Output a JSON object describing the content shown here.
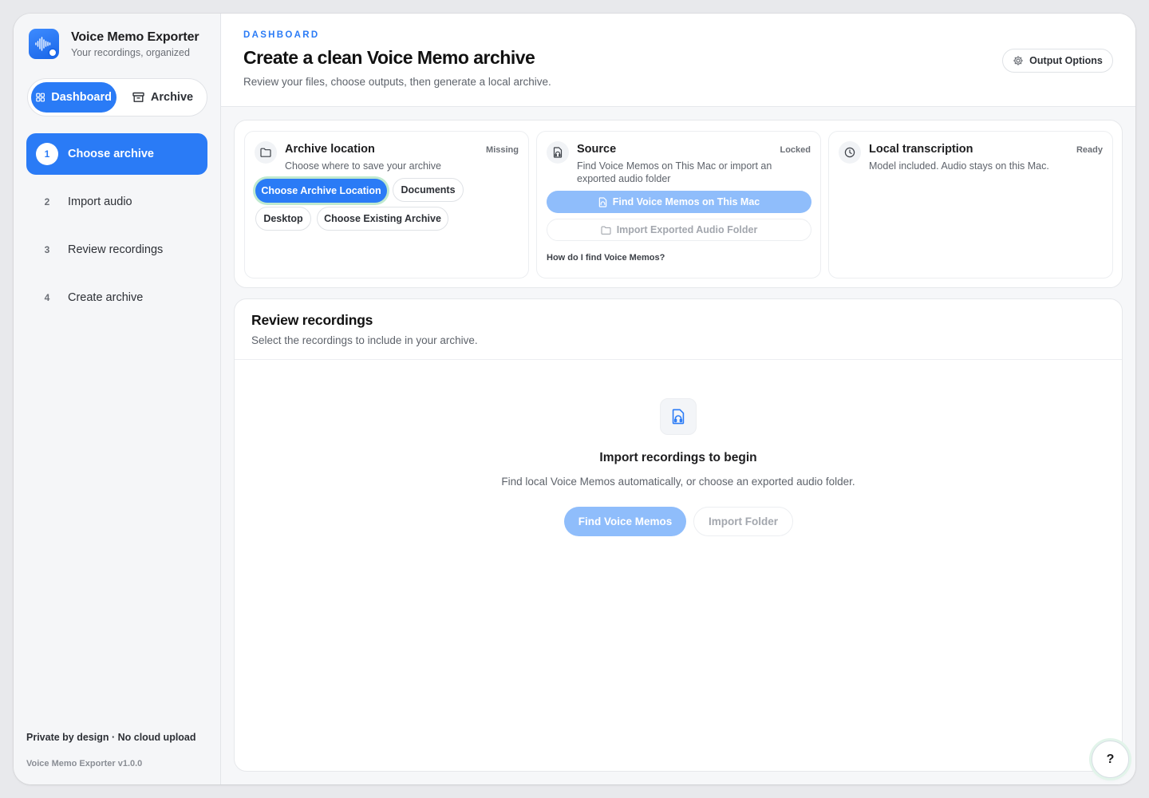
{
  "app": {
    "title": "Voice Memo Exporter",
    "subtitle": "Your recordings, organized",
    "accent": "#2a7bf6"
  },
  "nav": {
    "dashboard": "Dashboard",
    "archive": "Archive"
  },
  "steps": [
    {
      "num": "1",
      "label": "Choose archive",
      "active": true
    },
    {
      "num": "2",
      "label": "Import audio",
      "active": false
    },
    {
      "num": "3",
      "label": "Review recordings",
      "active": false
    },
    {
      "num": "4",
      "label": "Create archive",
      "active": false
    }
  ],
  "footer": {
    "privacy": "Private by design · No cloud upload",
    "version": "Voice Memo Exporter v1.0.0"
  },
  "header": {
    "eyebrow": "DASHBOARD",
    "title": "Create a clean Voice Memo archive",
    "subtitle": "Review your files, choose outputs, then generate a local archive.",
    "output_options": "Output Options"
  },
  "cards": {
    "archive": {
      "title": "Archive location",
      "status": "Missing",
      "desc": "Choose where to save your archive",
      "choose_location": "Choose Archive Location",
      "documents": "Documents",
      "desktop": "Desktop",
      "choose_existing": "Choose Existing Archive",
      "icon": "folder-icon"
    },
    "source": {
      "title": "Source",
      "status": "Locked",
      "desc": "Find Voice Memos on This Mac or import an exported audio folder",
      "find": "Find Voice Memos on This Mac",
      "import": "Import Exported Audio Folder",
      "help": "How do I find Voice Memos?",
      "icon": "audio-file-icon"
    },
    "transcription": {
      "title": "Local transcription",
      "status": "Ready",
      "desc": "Model included. Audio stays on this Mac.",
      "icon": "clock-icon"
    }
  },
  "review": {
    "title": "Review recordings",
    "subtitle": "Select the recordings to include in your archive.",
    "empty_title": "Import recordings to begin",
    "empty_sub": "Find local Voice Memos automatically, or choose an exported audio folder.",
    "find_button": "Find Voice Memos",
    "import_button": "Import Folder"
  },
  "help_fab": "?"
}
